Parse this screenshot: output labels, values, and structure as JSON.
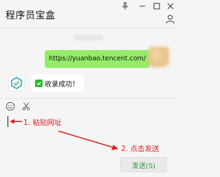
{
  "window": {
    "title": "程序员宝盒",
    "buttons": [
      "pin-icon",
      "minimize-icon",
      "maximize-icon",
      "close-icon"
    ]
  },
  "chat": {
    "messages": [
      {
        "direction": "outgoing",
        "text": "https://yuanbao.tencent.com/",
        "bubble_color": "#95ec69"
      },
      {
        "direction": "incoming",
        "text": "收录成功！",
        "prefix_icon": "green-checkmark-icon",
        "bubble_color": "#ffffff"
      }
    ]
  },
  "toolbar": {
    "icons": [
      "emoji-icon",
      "scissors-icon"
    ]
  },
  "annotations": {
    "step1": "1. 粘贴网址",
    "step2": "2. 点击发送",
    "color": "#e02020"
  },
  "send_button": {
    "label": "发送(S)",
    "text_color": "#2a9d2a"
  }
}
